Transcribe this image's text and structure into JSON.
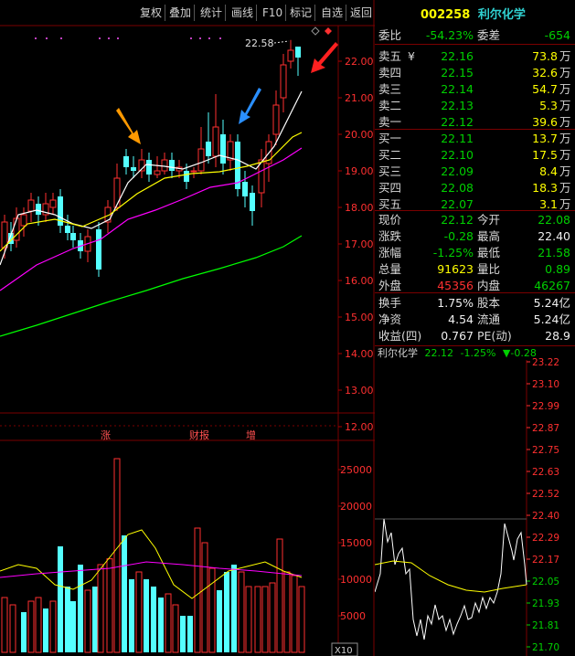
{
  "toolbar": {
    "buttons": [
      "复权",
      "叠加",
      "统计",
      "画线",
      "F10",
      "标记",
      "自选",
      "返回"
    ]
  },
  "chart": {
    "price_ticks": [
      "22.00",
      "21.00",
      "20.00",
      "19.00",
      "18.00",
      "17.00",
      "16.00",
      "15.00",
      "14.00",
      "13.00",
      "12.00"
    ],
    "volume_ticks": [
      "25000",
      "20000",
      "15000",
      "10000",
      "5000"
    ],
    "volume_unit": "X10",
    "peak_label": "22.58",
    "event_tags": [
      "涨",
      "财报",
      "增"
    ]
  },
  "quote": {
    "code": "002258",
    "name": "利尔化学",
    "ratio_label": "委比",
    "ratio_value": "-54.23%",
    "diff_label": "委差",
    "diff_value": "-654",
    "asks": [
      {
        "label": "卖五",
        "price": "22.16",
        "vol": "73.8",
        "unit": "万",
        "mark": "¥"
      },
      {
        "label": "卖四",
        "price": "22.15",
        "vol": "32.6",
        "unit": "万",
        "mark": ""
      },
      {
        "label": "卖三",
        "price": "22.14",
        "vol": "54.7",
        "unit": "万",
        "mark": ""
      },
      {
        "label": "卖二",
        "price": "22.13",
        "vol": "5.3",
        "unit": "万",
        "mark": ""
      },
      {
        "label": "卖一",
        "price": "22.12",
        "vol": "39.6",
        "unit": "万",
        "mark": ""
      }
    ],
    "bids": [
      {
        "label": "买一",
        "price": "22.11",
        "vol": "13.7",
        "unit": "万"
      },
      {
        "label": "买二",
        "price": "22.10",
        "vol": "17.5",
        "unit": "万"
      },
      {
        "label": "买三",
        "price": "22.09",
        "vol": "8.4",
        "unit": "万"
      },
      {
        "label": "买四",
        "price": "22.08",
        "vol": "18.3",
        "unit": "万"
      },
      {
        "label": "买五",
        "price": "22.07",
        "vol": "3.1",
        "unit": "万"
      }
    ],
    "stats": [
      {
        "l1": "现价",
        "v1": "22.12",
        "c1": "green",
        "l2": "今开",
        "v2": "22.08",
        "c2": "green"
      },
      {
        "l1": "涨跌",
        "v1": "-0.28",
        "c1": "green",
        "l2": "最高",
        "v2": "22.40",
        "c2": "white"
      },
      {
        "l1": "涨幅",
        "v1": "-1.25%",
        "c1": "green",
        "l2": "最低",
        "v2": "21.58",
        "c2": "green"
      },
      {
        "l1": "总量",
        "v1": "91623",
        "c1": "yellow",
        "l2": "量比",
        "v2": "0.89",
        "c2": "green"
      },
      {
        "l1": "外盘",
        "v1": "45356",
        "c1": "red",
        "l2": "内盘",
        "v2": "46267",
        "c2": "green"
      }
    ],
    "finance": [
      {
        "l1": "换手",
        "v1": "1.75%",
        "l2": "股本",
        "v2": "5.24亿"
      },
      {
        "l1": "净资",
        "v1": "4.54",
        "l2": "流通",
        "v2": "5.24亿"
      },
      {
        "l1": "收益(四)",
        "v1": "0.767",
        "l2": "PE(动)",
        "v2": "28.9"
      }
    ]
  },
  "mini": {
    "title": "利尔化学",
    "price": "22.12",
    "change_pct": "-1.25%",
    "change": "▼-0.28",
    "ticks": [
      "23.22",
      "23.10",
      "22.99",
      "22.87",
      "22.75",
      "22.63",
      "22.52",
      "22.40",
      "22.29",
      "22.17",
      "22.05",
      "21.93",
      "21.81",
      "21.70"
    ]
  },
  "colors": {
    "up": "#ff3030",
    "down": "#54ffff",
    "ma5": "#ffffff",
    "ma10": "#ffff00",
    "ma20": "#ff00ff",
    "ma60": "#00ff00"
  }
}
